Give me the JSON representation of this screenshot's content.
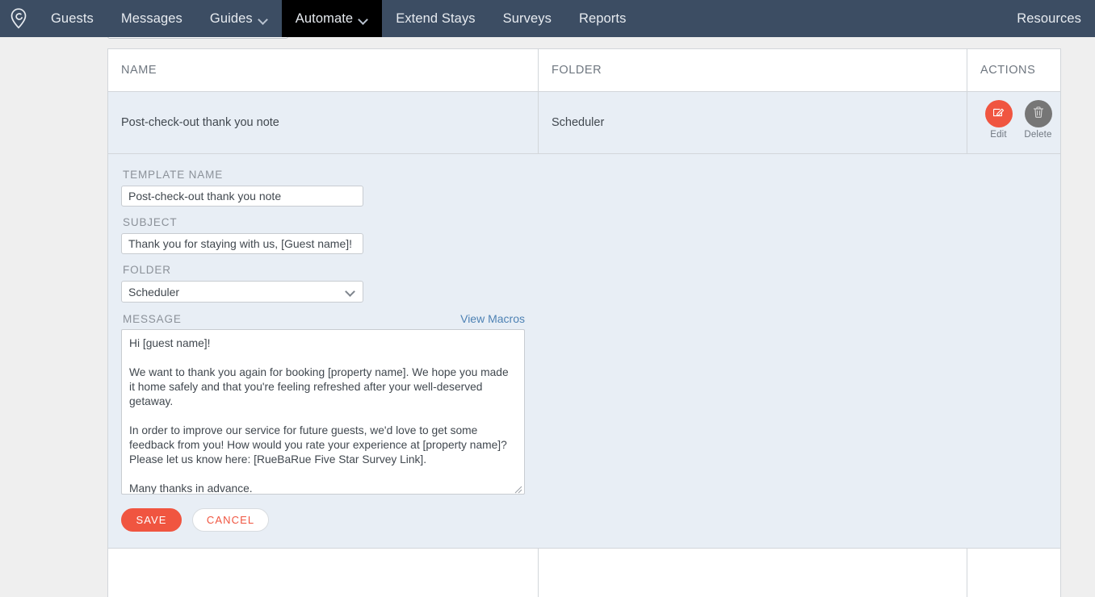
{
  "nav": {
    "logo_icon": "location-pin-logo-icon",
    "items": [
      {
        "label": "Guests",
        "has_caret": false,
        "active": false
      },
      {
        "label": "Messages",
        "has_caret": false,
        "active": false
      },
      {
        "label": "Guides",
        "has_caret": true,
        "active": false
      },
      {
        "label": "Automate",
        "has_caret": true,
        "active": true
      },
      {
        "label": "Extend Stays",
        "has_caret": false,
        "active": false
      },
      {
        "label": "Surveys",
        "has_caret": false,
        "active": false
      },
      {
        "label": "Reports",
        "has_caret": false,
        "active": false
      }
    ],
    "right_item": {
      "label": "Resources"
    },
    "bg_color": "#3c4d63",
    "active_bg_color": "#000000"
  },
  "table": {
    "columns": [
      "NAME",
      "FOLDER",
      "ACTIONS"
    ],
    "rows": [
      {
        "name": "Post-check-out thank you note",
        "folder": "Scheduler",
        "actions": [
          {
            "label": "Edit",
            "icon": "pencil-square-icon",
            "color": "#f05540"
          },
          {
            "label": "Delete",
            "icon": "trash-icon",
            "color": "#767676"
          }
        ]
      }
    ]
  },
  "form": {
    "template_name": {
      "label": "TEMPLATE NAME",
      "value": "Post-check-out thank you note",
      "placeholder": "Template name"
    },
    "subject": {
      "label": "SUBJECT",
      "value": "Thank you for staying with us, [Guest name]!",
      "placeholder": "Subject"
    },
    "folder": {
      "label": "FOLDER",
      "value": "Scheduler",
      "options": [
        "Scheduler"
      ]
    },
    "message": {
      "label": "MESSAGE",
      "view_macros_link": "View Macros",
      "value": "Hi [guest name]!\n\nWe want to thank you again for booking [property name]. We hope you made it home safely and that you're feeling refreshed after your well-deserved getaway.\n\nIn order to improve our service for future guests, we'd love to get some feedback from you! How would you rate your experience at [property name]? Please let us know here: [RueBaRue Five Star Survey Link].\n\nMany thanks in advance."
    },
    "buttons": {
      "save": "SAVE",
      "cancel": "CANCEL"
    }
  },
  "theme": {
    "accent": "#f05540",
    "nav_bg": "#3c4d63",
    "row_highlight": "#e8eef5",
    "link": "#4e82b4",
    "page_bg": "#efefef"
  }
}
